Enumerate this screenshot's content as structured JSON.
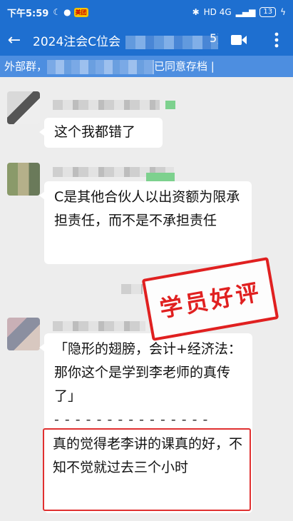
{
  "statusbar": {
    "time": "下午5:59",
    "app_badge": "美团",
    "network": "HD 4G",
    "battery": "13"
  },
  "appbar": {
    "back": "←",
    "title": "2024注会C位会",
    "title_suffix": "5)"
  },
  "notice": {
    "text_start": "外部群，",
    "text_end": "已同意存档 |"
  },
  "messages": [
    {
      "text": "这个我都错了"
    },
    {
      "text": "C是其他合伙人以出资额为限承担责任，而不是不承担责任"
    },
    {
      "quote": "「隐形的翅膀，会计+经济法：那你这个是学到李老师的真传了」",
      "separator": "- - - - - - - - - - - - - - -",
      "reply": "真的觉得老李讲的课真的好，不知不觉就过去三个小时"
    }
  ],
  "stamp": {
    "text": "学员好评"
  }
}
